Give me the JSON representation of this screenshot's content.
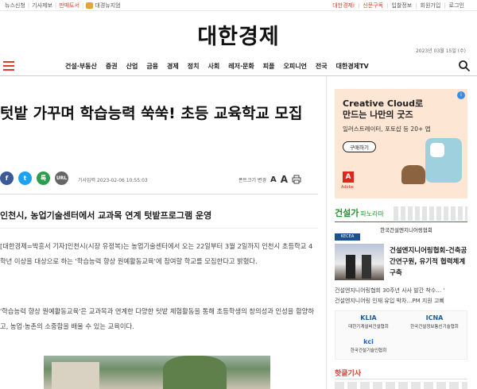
{
  "topbar": {
    "left_items": [
      "뉴스신청",
      "기사제보",
      "판매도서",
      "대경뉴지엄"
    ],
    "right_items": [
      "대한경제i",
      "신문구독",
      "입찰정보",
      "회원가입",
      "로그인"
    ]
  },
  "masthead": {
    "title": "대한경제",
    "date": "2023년 03월 15일 (수)"
  },
  "nav": {
    "items": [
      "건설·부동산",
      "증권",
      "산업",
      "금융",
      "경제",
      "정치",
      "사회",
      "레저·문화",
      "피플",
      "오피니언",
      "전국",
      "대한경제TV"
    ]
  },
  "article": {
    "headline": "텃밭 가꾸며 학습능력 쑥쑥! 초등 교육학교 모집",
    "share": {
      "fb": "f",
      "tw": "t",
      "ks": "톡",
      "url": "URL"
    },
    "date": "기사입력 2023-02-06 10:55:03",
    "font_label": "폰트크기 변경",
    "font_small": "A",
    "font_large": "A",
    "subtitle": "인천시, 농업기술센터에서 교과목 연계 텃밭프로그램 운영",
    "para1": "[대한경제=박흥서 기자]인천시(시장 유정복)는 농업기술센터에서 오는 22일부터 3월 2일까지 인천시 초등학교 4학년 이상을 대상으로 하는 '학습능력 향상 원예활동교육'에 참여할 학교를 모집한다고 밝혔다.",
    "para2": "'학습능력 향상 원예활동교육'은 교과목과 연계한 다양한 텃밭 체험활동을 통해 초등학생의 창의성과 인성을 함양하고, 농업·농촌의 소중함을 배울 수 있는 교육이다."
  },
  "sidebar": {
    "ad": {
      "line1": "Creative Cloud로",
      "line2": "만드는 나만의 굿즈",
      "sub": "일러스트레이터, 포토샵 등 20+ 앱",
      "button": "구매하기",
      "brand_mark": "A",
      "brand": "Adobe"
    },
    "section_title": "건설가",
    "section_sub": "파노라마",
    "source_logo": "KECEA",
    "source_name": "한국건설엔지니어링협회",
    "news_headline": "건설엔지니어링협회-건축공간연구원, 유기적 협력체계 구축",
    "news_list": [
      "건설엔지니어링협회 30주년 사사 발간 착수… '",
      "건설엔지니어링 인재 유입 박차…PM 지원 고삐"
    ],
    "logos": [
      {
        "mark": "KLIA",
        "name": "대한기계설비건설협회"
      },
      {
        "mark": "ICNA",
        "name": "한국건설정보통신기술협회"
      },
      {
        "mark": "kci",
        "name": "한국건설기술인협회"
      }
    ],
    "hot_title": "핫클기사"
  },
  "colors": {
    "accent": "#d6402f",
    "green": "#2d8f3a"
  }
}
